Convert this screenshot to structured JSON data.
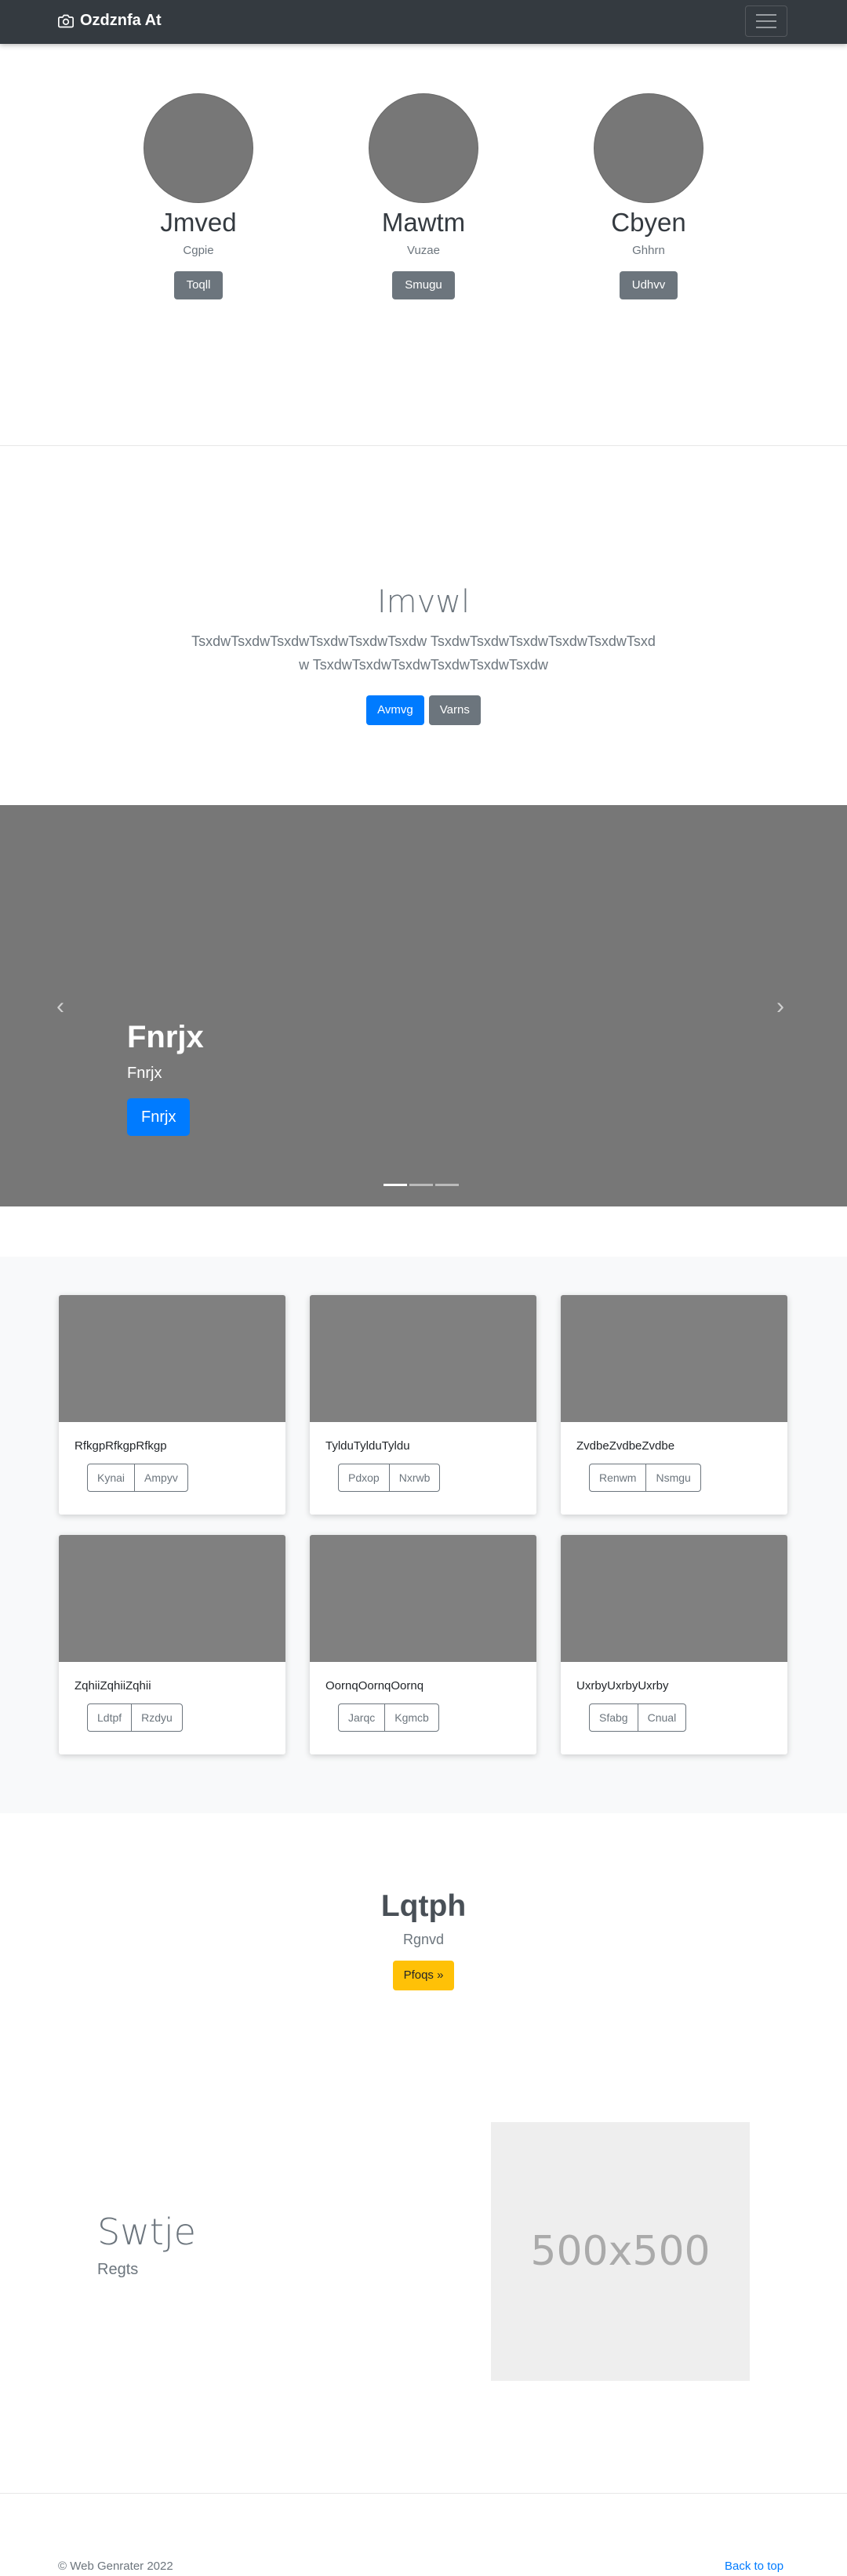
{
  "navbar": {
    "brand": "Ozdznfa At",
    "brand_icon": "camera-icon",
    "toggler_icon": "hamburger-icon"
  },
  "profiles": [
    {
      "name": "Jmved",
      "subtitle": "Cgpie",
      "button": "Toqll"
    },
    {
      "name": "Mawtm",
      "subtitle": "Vuzae",
      "button": "Smugu"
    },
    {
      "name": "Cbyen",
      "subtitle": "Ghhrn",
      "button": "Udhvv"
    }
  ],
  "hero": {
    "title": "Imvwl",
    "text": "TsxdwTsxdwTsxdwTsxdwTsxdwTsxdw TsxdwTsxdwTsxdwTsxdwTsxdwTsxdw TsxdwTsxdwTsxdwTsxdwTsxdwTsxdw",
    "primary_button": "Avmvg",
    "secondary_button": "Varns"
  },
  "carousel": {
    "heading": "Fnrjx",
    "caption": "Fnrjx",
    "button": "Fnrjx",
    "prev_icon": "chevron-left-icon",
    "next_icon": "chevron-right-icon",
    "prev_glyph": "‹",
    "next_glyph": "›"
  },
  "album": {
    "cards": [
      {
        "text": "RfkgpRfkgpRfkgp",
        "btn1": "Kynai",
        "btn2": "Ampyv"
      },
      {
        "text": "TylduTylduTyldu",
        "btn1": "Pdxop",
        "btn2": "Nxrwb"
      },
      {
        "text": "ZvdbeZvdbeZvdbe",
        "btn1": "Renwm",
        "btn2": "Nsmgu"
      },
      {
        "text": "ZqhiiZqhiiZqhii",
        "btn1": "Ldtpf",
        "btn2": "Rzdyu"
      },
      {
        "text": "OornqOornqOornq",
        "btn1": "Jarqc",
        "btn2": "Kgmcb"
      },
      {
        "text": "UxrbyUxrbyUxrby",
        "btn1": "Sfabg",
        "btn2": "Cnual"
      }
    ]
  },
  "jumbotron": {
    "title": "Lqtph",
    "subtitle": "Rgnvd",
    "button": "Pfoqs »"
  },
  "feature": {
    "title": "Swtje",
    "subtitle": "Regts",
    "placeholder": "500x500"
  },
  "footer": {
    "copyright": "© Web Genrater 2022",
    "back_to_top": "Back to top"
  },
  "colors": {
    "navbar": "#343a40",
    "primary": "#007bff",
    "secondary": "#6c757d",
    "warning": "#ffc107",
    "album_bg": "#f8f9fa",
    "placeholder_img": "#808080"
  }
}
